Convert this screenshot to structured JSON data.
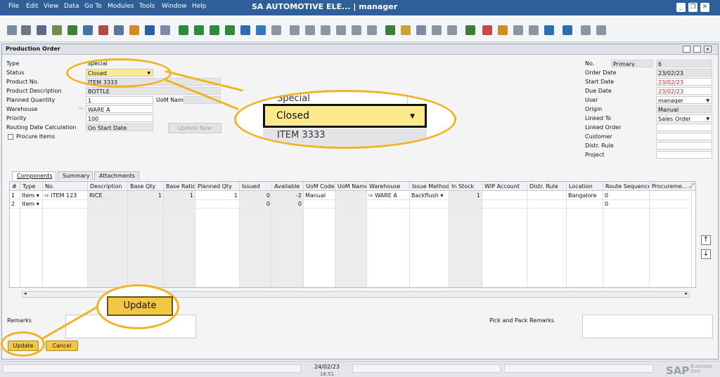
{
  "menu": [
    "File",
    "Edit",
    "View",
    "Data",
    "Go To",
    "Modules",
    "Tools",
    "Window",
    "Help"
  ],
  "app_title": "SA AUTOMOTIVE ELE... | manager",
  "window_controls": {
    "minimize": "_",
    "restore": "❐",
    "close": "✕"
  },
  "window": {
    "title": "Production Order"
  },
  "header_left": {
    "type_label": "Type",
    "type_value": "Special",
    "status_label": "Status",
    "status_value": "Closed",
    "product_no_label": "Product No.",
    "product_no_value": "ITEM 3333",
    "product_desc_label": "Product Description",
    "product_desc_value": "BOTTLE",
    "planned_qty_label": "Planned Quantity",
    "planned_qty_value": "1",
    "uom_label": "UoM Name",
    "warehouse_label": "Warehouse",
    "warehouse_value": "WARE A",
    "priority_label": "Priority",
    "priority_value": "100",
    "routing_label": "Routing Date Calculation",
    "routing_value": "On Start Date",
    "update_now": "Update Now",
    "procure_label": "Procure Items"
  },
  "header_right": {
    "no_label": "No.",
    "no_series": "Primary",
    "no_value": "6",
    "order_date_label": "Order Date",
    "order_date_value": "23/02/23",
    "start_date_label": "Start Date",
    "start_date_value": "23/02/23",
    "due_date_label": "Due Date",
    "due_date_value": "23/02/23",
    "user_label": "User",
    "user_value": "manager",
    "origin_label": "Origin",
    "origin_value": "Manual",
    "linked_to_label": "Linked To",
    "linked_to_value": "Sales Order",
    "linked_order_label": "Linked Order",
    "customer_label": "Customer",
    "distr_rule_label": "Distr. Rule",
    "project_label": "Project"
  },
  "tabs": [
    "Components",
    "Summary",
    "Attachments"
  ],
  "grid": {
    "columns": [
      "#",
      "Type",
      "No.",
      "Description",
      "Base Qty",
      "Base Ratio",
      "Planned Qty",
      "Issued",
      "Available",
      "UoM Code",
      "UoM Name",
      "Warehouse",
      "Issue Method",
      "In Stock",
      "WIP Account",
      "Distr. Rule",
      "Location",
      "Route Sequence",
      "Procureme..."
    ],
    "rows": [
      [
        "1",
        "Item",
        "ITEM 123",
        "RICE",
        "1",
        "1",
        "1",
        "0",
        "-2",
        "Manual",
        "",
        "WARE A",
        "Backflush",
        "1",
        "",
        "",
        "Bangalore",
        "0",
        ""
      ],
      [
        "2",
        "Item",
        "",
        "",
        "",
        "",
        "",
        "0",
        "0",
        "",
        "",
        "",
        "",
        "",
        "",
        "",
        "",
        "0",
        ""
      ]
    ]
  },
  "remarks_label": "Remarks",
  "pick_pack_label": "Pick and Pack Remarks",
  "buttons": {
    "update": "Update",
    "cancel": "Cancel"
  },
  "callouts": {
    "type_value": "Special",
    "status_value": "Closed",
    "product_value": "ITEM 3333",
    "update_button": "Update"
  },
  "statusbar": {
    "date": "24/02/23",
    "time": "16:51"
  },
  "brand": {
    "logo": "SAP",
    "sub": "Business One"
  },
  "colors": {
    "menubar": "#2f5f99",
    "accent": "#f0b323",
    "button": "#f2c744",
    "red": "#cc1b1b"
  }
}
